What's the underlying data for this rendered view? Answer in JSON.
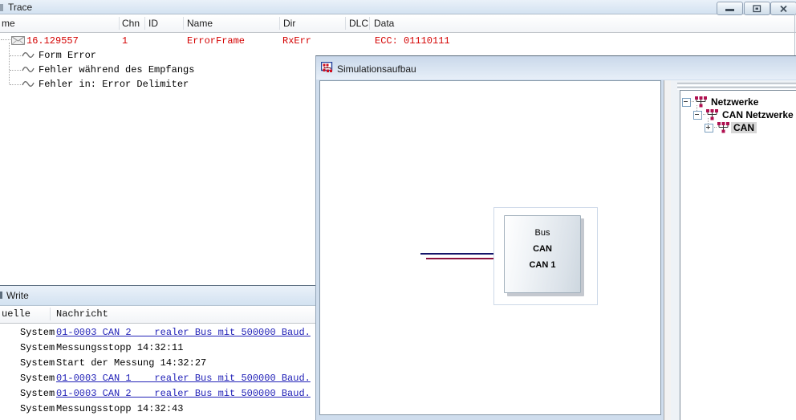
{
  "trace": {
    "title": "Trace",
    "columns": [
      "me",
      "Chn",
      "ID",
      "Name",
      "Dir",
      "DLC",
      "Data"
    ],
    "error_row": {
      "time": "16.129557",
      "chn": "1",
      "name": "ErrorFrame",
      "dir": "RxErr",
      "data": "ECC: 01110111"
    },
    "details": [
      "Form Error",
      "Fehler während des Empfangs",
      "Fehler in: Error Delimiter"
    ]
  },
  "write": {
    "title": "Write",
    "columns": [
      "uelle",
      "Nachricht"
    ],
    "rows": [
      {
        "source": "System",
        "message": "01-0003 CAN 2    realer Bus mit 500000 Baud.",
        "link": true
      },
      {
        "source": "System",
        "message": "Messungsstopp 14:32:11",
        "link": false
      },
      {
        "source": "System",
        "message": "Start der Messung 14:32:27",
        "link": false
      },
      {
        "source": "System",
        "message": "01-0003 CAN 1    realer Bus mit 500000 Baud.",
        "link": true
      },
      {
        "source": "System",
        "message": "01-0003 CAN 2    realer Bus mit 500000 Baud.",
        "link": true
      },
      {
        "source": "System",
        "message": "Messungsstopp 14:32:43",
        "link": false
      }
    ]
  },
  "sim": {
    "title": "Simulationsaufbau",
    "bus_block": {
      "type_label": "Bus",
      "bus_name": "CAN",
      "channel": "CAN 1"
    },
    "tree": [
      {
        "label": "Netzwerke",
        "toggle": "minus",
        "level": 0,
        "selected": false
      },
      {
        "label": "CAN Netzwerke",
        "toggle": "minus",
        "level": 1,
        "selected": false
      },
      {
        "label": "CAN",
        "toggle": "plus",
        "level": 2,
        "selected": true
      }
    ]
  },
  "window_buttons": [
    "minimize",
    "maximize",
    "close"
  ],
  "colors": {
    "error_text": "#d40000",
    "link_text": "#2323b8",
    "wire_blue": "#15156a",
    "wire_red": "#8c1240",
    "net_icon": "#b01050",
    "titlebar_gradient_top": "#eaf1f9",
    "titlebar_gradient_bottom": "#d3e2f1"
  }
}
